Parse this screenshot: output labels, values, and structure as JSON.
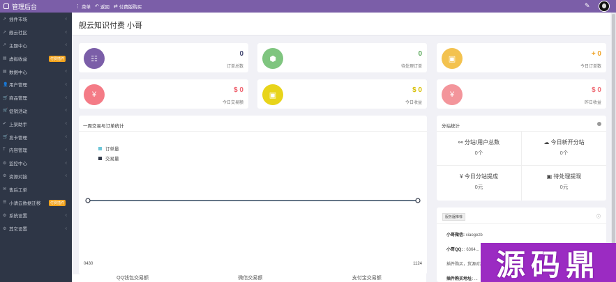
{
  "topbar": {
    "brand": "管理后台",
    "nav": [
      {
        "icon": "⋮",
        "label": "菜单"
      },
      {
        "icon": "↶",
        "label": "返回"
      },
      {
        "icon": "⇄",
        "label": "付费版购买"
      }
    ],
    "colors": {
      "bar": "#7b5ea8",
      "sidebar": "#2e3646"
    }
  },
  "sidebar": {
    "items": [
      {
        "icon": "↗",
        "label": "插件市场"
      },
      {
        "icon": "↗",
        "label": "舰云社区"
      },
      {
        "icon": "↗",
        "label": "主题中心"
      },
      {
        "icon": "▤",
        "label": "虚拟收益",
        "badge": "付费插件"
      },
      {
        "icon": "▤",
        "label": "数据中心"
      },
      {
        "icon": "👤",
        "label": "用户管理"
      },
      {
        "icon": "🛒",
        "label": "商品管理"
      },
      {
        "icon": "🛒",
        "label": "促销活动"
      },
      {
        "icon": "✔",
        "label": "上架助手"
      },
      {
        "icon": "🛒",
        "label": "发卡管理"
      },
      {
        "icon": "T",
        "label": "内容管理"
      },
      {
        "icon": "⚙",
        "label": "监控中心"
      },
      {
        "icon": "⚙",
        "label": "资源对接"
      },
      {
        "icon": "✉",
        "label": "售后工单"
      },
      {
        "icon": "☰",
        "label": "小请云数据迁移",
        "badge": "付费插件"
      },
      {
        "icon": "⚙",
        "label": "系统设置"
      },
      {
        "icon": "⚙",
        "label": "其它设置"
      }
    ]
  },
  "header": {
    "title": "舰云知识付费 小哥"
  },
  "stats": [
    {
      "value": "0",
      "label": "订单总数",
      "color": "#7b5ea8",
      "value_color": "#3b3f6b",
      "icon": "☷"
    },
    {
      "value": "0",
      "label": "待处理订单",
      "color": "#7fc57f",
      "value_color": "#5daa5d",
      "icon": "⬢"
    },
    {
      "value": "+ 0",
      "label": "今日订单数",
      "color": "#f3c24f",
      "value_color": "#f0a52a",
      "icon": "▣"
    },
    {
      "value": "$ 0",
      "label": "今日交易额",
      "color": "#f47b86",
      "value_color": "#ef5e6b",
      "icon": "¥"
    },
    {
      "value": "$ 0",
      "label": "今日收益",
      "color": "#e8d41a",
      "value_color": "#d7be00",
      "icon": "▣"
    },
    {
      "value": "$ 0",
      "label": "昨日收益",
      "color": "#f3959b",
      "value_color": "#ef6a73",
      "icon": "¥"
    }
  ],
  "chart_panel": {
    "title": "一周交易与订单统计",
    "legend": [
      {
        "name": "订单量",
        "color": "#6ec6d8"
      },
      {
        "name": "交易量",
        "color": "#333a4a"
      }
    ]
  },
  "chart_data": {
    "type": "line",
    "x": [
      "0430",
      "1124"
    ],
    "series": [
      {
        "name": "订单量",
        "values": [
          0,
          0
        ]
      },
      {
        "name": "交易量",
        "values": [
          0,
          0
        ]
      }
    ],
    "grid": false,
    "legend": "top-left"
  },
  "bottom_tabs": [
    "QQ钱包交易额",
    "微信交易额",
    "支付宝交易额"
  ],
  "substation": {
    "title": "分站统计",
    "cells": [
      {
        "icon": "⚯",
        "title": "分站/用户总数",
        "value": "0个"
      },
      {
        "icon": "☁",
        "title": "今日新开分站",
        "value": "0个"
      },
      {
        "icon": "¥",
        "title": "今日分站提成",
        "value": "0元"
      },
      {
        "icon": "▣",
        "title": "待处理提现",
        "value": "0元"
      }
    ]
  },
  "recommend": {
    "tag": "服务器推荐",
    "lines": [
      {
        "label": "小哥微信:",
        "value": "xiaogezb"
      },
      {
        "label": "小哥QQ:",
        "value": ": 6364..."
      },
      {
        "label": "",
        "value": "插件购买，货源对接..."
      },
      {
        "label": "插件购买地址:",
        "value": "..."
      }
    ]
  },
  "watermark": "源码鼎"
}
